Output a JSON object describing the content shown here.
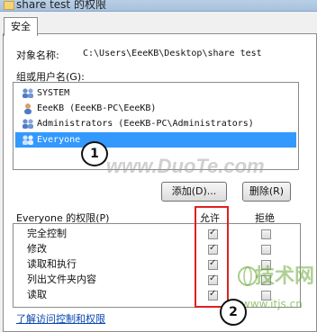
{
  "window": {
    "title": "share test 的权限"
  },
  "tabs": [
    {
      "label": "安全"
    }
  ],
  "object": {
    "label": "对象名称:",
    "value": "C:\\Users\\EeeKB\\Desktop\\share test"
  },
  "groups": {
    "label": "组或用户名(G):",
    "items": [
      {
        "name": "SYSTEM",
        "selected": false
      },
      {
        "name": "EeeKB (EeeKB-PC\\EeeKB)",
        "selected": false
      },
      {
        "name": "Administrators (EeeKB-PC\\Administrators)",
        "selected": false
      },
      {
        "name": "Everyone",
        "selected": true
      }
    ]
  },
  "buttons": {
    "add": "添加(D)...",
    "remove": "删除(R)"
  },
  "permissions": {
    "label": "Everyone 的权限(P)",
    "allow_header": "允许",
    "deny_header": "拒绝",
    "rows": [
      {
        "name": "完全控制",
        "allow": true,
        "deny": false
      },
      {
        "name": "修改",
        "allow": true,
        "deny": false
      },
      {
        "name": "读取和执行",
        "allow": true,
        "deny": false
      },
      {
        "name": "列出文件夹内容",
        "allow": true,
        "deny": false
      },
      {
        "name": "读取",
        "allow": true,
        "deny": false
      }
    ]
  },
  "link": "了解访问控制和权限",
  "annotations": {
    "one": "1",
    "two": "2"
  },
  "watermarks": {
    "duote": "www.DuoTe.com",
    "jishu": "技术网",
    "itjs": "www.itjs.cn"
  },
  "colors": {
    "selection": "#3399ff",
    "annotation_red": "#e02020",
    "link": "#0645ad"
  }
}
